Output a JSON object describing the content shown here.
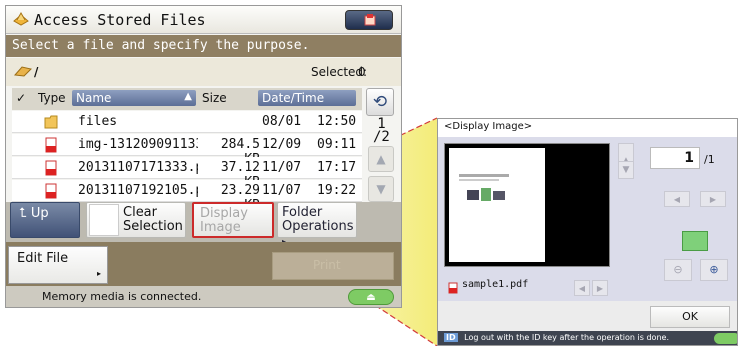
{
  "window": {
    "title": "Access Stored Files"
  },
  "instruction": "Select a file and specify the purpose.",
  "path": {
    "current": "/",
    "selected_label": "Selected:",
    "selected_count": "0"
  },
  "table": {
    "headers": {
      "type": "Type",
      "name": "Name",
      "size": "Size",
      "datetime": "Date/Time"
    },
    "rows": [
      {
        "icon": "folder-icon",
        "name": "files",
        "size": "",
        "date": "08/01",
        "time": "12:50"
      },
      {
        "icon": "pdf-icon",
        "name": "img-131209091133.",
        "size": "284.5 KB",
        "date": "12/09",
        "time": "09:11"
      },
      {
        "icon": "pdf-icon",
        "name": "20131107171333.pd",
        "size": "37.12 KB",
        "date": "11/07",
        "time": "17:17"
      },
      {
        "icon": "pdf-icon",
        "name": "20131107192105.pd",
        "size": "23.29 KB",
        "date": "11/07",
        "time": "19:22"
      }
    ]
  },
  "pager": {
    "current": "1",
    "total": "/2"
  },
  "buttons": {
    "up": "Up",
    "clear_line1": "Clear",
    "clear_line2": "Selection",
    "display_line1": "Display",
    "display_line2": "Image",
    "folder_line1": "Folder",
    "folder_line2": "Operations",
    "edit_file": "Edit File",
    "print": "Print"
  },
  "status": "Memory media is connected.",
  "zoom": {
    "title": "<Display Image>",
    "filename": "sample1.pdf",
    "page_current": "1",
    "page_total": "/1",
    "ok": "OK",
    "logout_notice": "Log out with the ID key after the operation is done.",
    "id_badge": "ID"
  },
  "colors": {
    "accent_blue": "#415277",
    "header_brown": "#8f7f62",
    "highlight_red": "#cc2a2a",
    "callout_yellow": "#f2ea6a",
    "eject_green": "#7ecb64"
  }
}
